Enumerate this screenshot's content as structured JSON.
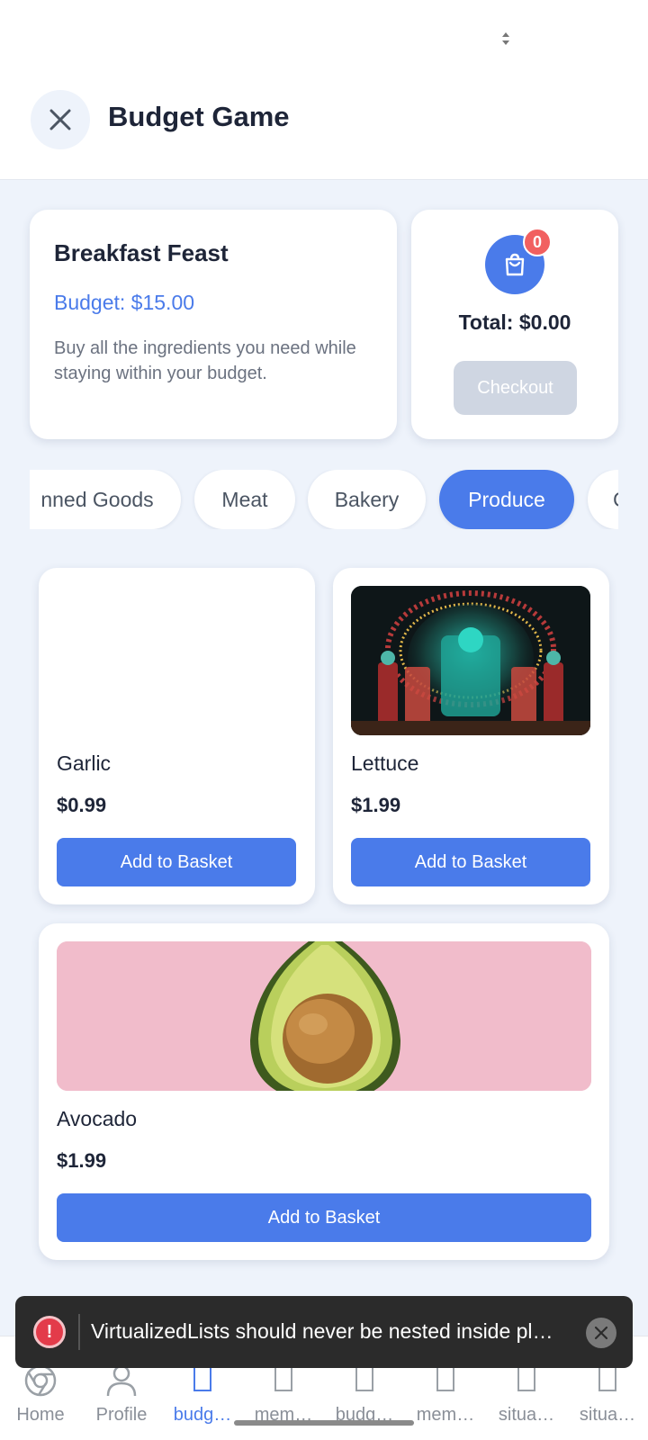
{
  "header": {
    "title": "Budget Game"
  },
  "challenge": {
    "title": "Breakfast Feast",
    "budget": "Budget: $15.00",
    "description": "Buy all the ingredients you need while staying within your budget."
  },
  "cart": {
    "count": "0",
    "total": "Total: $0.00",
    "checkout_label": "Checkout"
  },
  "categories": [
    {
      "label": "nned Goods",
      "active": false
    },
    {
      "label": "Meat",
      "active": false
    },
    {
      "label": "Bakery",
      "active": false
    },
    {
      "label": "Produce",
      "active": true
    },
    {
      "label": "C",
      "active": false
    }
  ],
  "products": [
    {
      "name": "Garlic",
      "price": "$0.99",
      "button": "Add to Basket",
      "image": "none"
    },
    {
      "name": "Lettuce",
      "price": "$1.99",
      "button": "Add to Basket",
      "image": "festival-photo"
    },
    {
      "name": "Avocado",
      "price": "$1.99",
      "button": "Add to Basket",
      "image": "avocado-photo"
    }
  ],
  "toast": {
    "message": "VirtualizedLists should never be nested inside pl…"
  },
  "tabs": [
    {
      "label": "Home",
      "icon": "chrome-icon",
      "active": false
    },
    {
      "label": "Profile",
      "icon": "person-icon",
      "active": false
    },
    {
      "label": "budg…",
      "icon": "placeholder-icon",
      "active": true
    },
    {
      "label": "mem…",
      "icon": "placeholder-icon",
      "active": false
    },
    {
      "label": "budg…",
      "icon": "placeholder-icon",
      "active": false
    },
    {
      "label": "mem…",
      "icon": "placeholder-icon",
      "active": false
    },
    {
      "label": "situa…",
      "icon": "placeholder-icon",
      "active": false
    },
    {
      "label": "situa…",
      "icon": "placeholder-icon",
      "active": false
    }
  ],
  "colors": {
    "accent": "#4a7bea",
    "badge": "#f16060",
    "background": "#eef3fb"
  }
}
